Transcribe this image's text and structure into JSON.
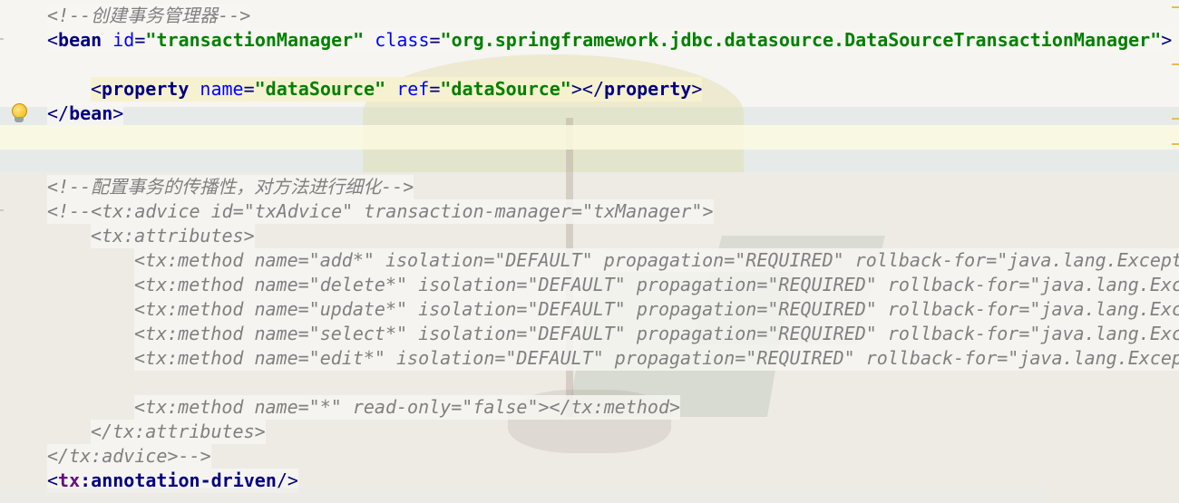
{
  "editor": {
    "lines": [
      {
        "indent": 0,
        "tokens": [
          {
            "t": "cm",
            "v": "<!--创建事务管理器-->"
          }
        ]
      },
      {
        "indent": 0,
        "tokens": [
          {
            "t": "tag",
            "v": "<"
          },
          {
            "t": "kw",
            "v": "bean"
          },
          {
            "t": "plain",
            "v": " "
          },
          {
            "t": "attr",
            "v": "id"
          },
          {
            "t": "tag",
            "v": "="
          },
          {
            "t": "val",
            "v": "\"transactionManager\""
          },
          {
            "t": "plain",
            "v": " "
          },
          {
            "t": "attr",
            "v": "class"
          },
          {
            "t": "tag",
            "v": "="
          },
          {
            "t": "val",
            "v": "\"org.springframework.jdbc.datasource.DataSourceTransactionManager\""
          },
          {
            "t": "tag",
            "v": ">"
          }
        ]
      },
      {
        "indent": 0,
        "tokens": []
      },
      {
        "indent": 4,
        "tokens": [
          {
            "t": "tag",
            "v": "<"
          },
          {
            "t": "kw",
            "v": "property"
          },
          {
            "t": "plain",
            "v": " "
          },
          {
            "t": "attr",
            "v": "name"
          },
          {
            "t": "tag",
            "v": "="
          },
          {
            "t": "val",
            "v": "\"dataSource\""
          },
          {
            "t": "plain",
            "v": " "
          },
          {
            "t": "attr",
            "v": "ref"
          },
          {
            "t": "tag",
            "v": "="
          },
          {
            "t": "val",
            "v": "\"dataSource\""
          },
          {
            "t": "tag",
            "v": "></"
          },
          {
            "t": "kw",
            "v": "property"
          },
          {
            "t": "tag",
            "v": ">"
          }
        ],
        "highlight": true
      },
      {
        "indent": 0,
        "tokens": [
          {
            "t": "tag",
            "v": "</"
          },
          {
            "t": "kw",
            "v": "bean"
          },
          {
            "t": "tag",
            "v": ">"
          }
        ]
      },
      {
        "indent": 0,
        "tokens": []
      },
      {
        "indent": 0,
        "tokens": []
      },
      {
        "indent": 0,
        "tokens": [
          {
            "t": "cm",
            "v": "<!--配置事务的传播性，对方法进行细化-->"
          }
        ]
      },
      {
        "indent": 0,
        "tokens": [
          {
            "t": "cm",
            "v": "<!--<tx:advice id=\"txAdvice\" transaction-manager=\"txManager\">"
          }
        ]
      },
      {
        "indent": 4,
        "tokens": [
          {
            "t": "cm",
            "v": "<tx:attributes>"
          }
        ]
      },
      {
        "indent": 8,
        "tokens": [
          {
            "t": "cm",
            "v": "<tx:method name=\"add*\" isolation=\"DEFAULT\" propagation=\"REQUIRED\" rollback-for=\"java.lang.Except"
          }
        ]
      },
      {
        "indent": 8,
        "tokens": [
          {
            "t": "cm",
            "v": "<tx:method name=\"delete*\" isolation=\"DEFAULT\" propagation=\"REQUIRED\" rollback-for=\"java.lang.Exc"
          }
        ]
      },
      {
        "indent": 8,
        "tokens": [
          {
            "t": "cm",
            "v": "<tx:method name=\"update*\" isolation=\"DEFAULT\" propagation=\"REQUIRED\" rollback-for=\"java.lang.Exc"
          }
        ]
      },
      {
        "indent": 8,
        "tokens": [
          {
            "t": "cm",
            "v": "<tx:method name=\"select*\" isolation=\"DEFAULT\" propagation=\"REQUIRED\" rollback-for=\"java.lang.Exc"
          }
        ]
      },
      {
        "indent": 8,
        "tokens": [
          {
            "t": "cm",
            "v": "<tx:method name=\"edit*\" isolation=\"DEFAULT\" propagation=\"REQUIRED\" rollback-for=\"java.lang.Excep"
          }
        ]
      },
      {
        "indent": 0,
        "tokens": []
      },
      {
        "indent": 8,
        "tokens": [
          {
            "t": "cm",
            "v": "<tx:method name=\"*\" read-only=\"false\"></tx:method>"
          }
        ]
      },
      {
        "indent": 4,
        "tokens": [
          {
            "t": "cm",
            "v": "</tx:attributes>"
          }
        ]
      },
      {
        "indent": 0,
        "tokens": [
          {
            "t": "cm",
            "v": "</tx:advice>-->"
          }
        ]
      },
      {
        "indent": 0,
        "tokens": [
          {
            "t": "tag",
            "v": "<"
          },
          {
            "t": "pfx",
            "v": "tx"
          },
          {
            "t": "kw",
            "v": ":annotation-driven"
          },
          {
            "t": "tag",
            "v": "/>"
          }
        ]
      }
    ]
  },
  "icons": {
    "bulb": "intention-bulb-icon"
  }
}
